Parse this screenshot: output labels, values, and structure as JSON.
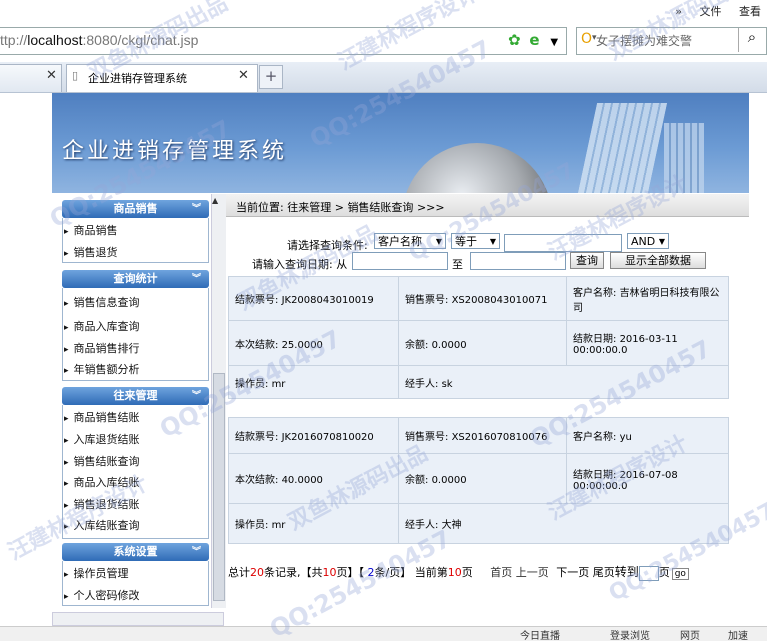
{
  "browser": {
    "menu": [
      "»",
      "文件",
      "查看"
    ],
    "url_prefix": "ttp://",
    "url_host": "localhost",
    "url_rest": ":8080/ckgl/chat.jsp",
    "search_placeholder": "女子摆摊为难交警",
    "tab_title": "企业进销存管理系统",
    "status_items": [
      "今日直播",
      "登录浏览",
      "网页",
      "加速"
    ]
  },
  "banner": {
    "title": "企业进销存管理系统"
  },
  "sidebar": {
    "sections": [
      {
        "title": "商品销售",
        "items": [
          "商品销售",
          "销售退货"
        ]
      },
      {
        "title": "查询统计",
        "items": [
          "销售信息查询",
          "商品入库查询",
          "商品销售排行",
          "年销售额分析"
        ]
      },
      {
        "title": "往来管理",
        "items": [
          "商品销售结账",
          "入库退货结账",
          "销售结账查询",
          "商品入库结账",
          "销售退货结账",
          "入库结账查询"
        ]
      },
      {
        "title": "系统设置",
        "items": [
          "操作员管理",
          "个人密码修改"
        ]
      }
    ]
  },
  "breadcrumb": {
    "prefix": "当前位置:",
    "level1": "往来管理",
    "sep": ">",
    "level2": "销售结账查询",
    "tail": ">>>"
  },
  "query": {
    "condition_label": "请选择查询条件:",
    "field_select": "客户名称",
    "op_select": "等于",
    "logic_select": "AND",
    "date_label": "请输入查询日期: 从",
    "date_to": "至",
    "query_button": "查询",
    "show_all_button": "显示全部数据"
  },
  "records": [
    {
      "jk_label": "结款票号:",
      "jk": "JK2008043010019",
      "xs_label": "销售票号:",
      "xs": "XS2008043010071",
      "cust_label": "客户名称:",
      "cust": "吉林省明日科技有限公司",
      "amt_label": "本次结款:",
      "amt": "25.0000",
      "bal_label": "余额:",
      "bal": "0.0000",
      "date_label": "结款日期:",
      "date": "2016-03-11 00:00:00.0",
      "op_label": "操作员:",
      "op": "mr",
      "handler_label": "经手人:",
      "handler": "sk"
    },
    {
      "jk_label": "结款票号:",
      "jk": "JK2016070810020",
      "xs_label": "销售票号:",
      "xs": "XS2016070810076",
      "cust_label": "客户名称:",
      "cust": "yu",
      "amt_label": "本次结款:",
      "amt": "40.0000",
      "bal_label": "余额:",
      "bal": "0.0000",
      "date_label": "结款日期:",
      "date": "2016-07-08 00:00:00.0",
      "op_label": "操作员:",
      "op": "mr",
      "handler_label": "经手人:",
      "handler": "大神"
    }
  ],
  "pager": {
    "t1": "总计",
    "total": "20",
    "t2": "条记录,【共",
    "pages": "10",
    "t3": "页】【",
    "per": "2",
    "t4": "条/页】 当前第",
    "current": "10",
    "t5": "页",
    "first": "首页",
    "prev": "上一页",
    "next": "下一页",
    "last": "尾页",
    "goto": "转到",
    "page_unit": "页",
    "go": "go"
  },
  "watermarks": [
    "汪建林程序设计",
    "双鱼林源码出品",
    "QQ:254540457"
  ]
}
